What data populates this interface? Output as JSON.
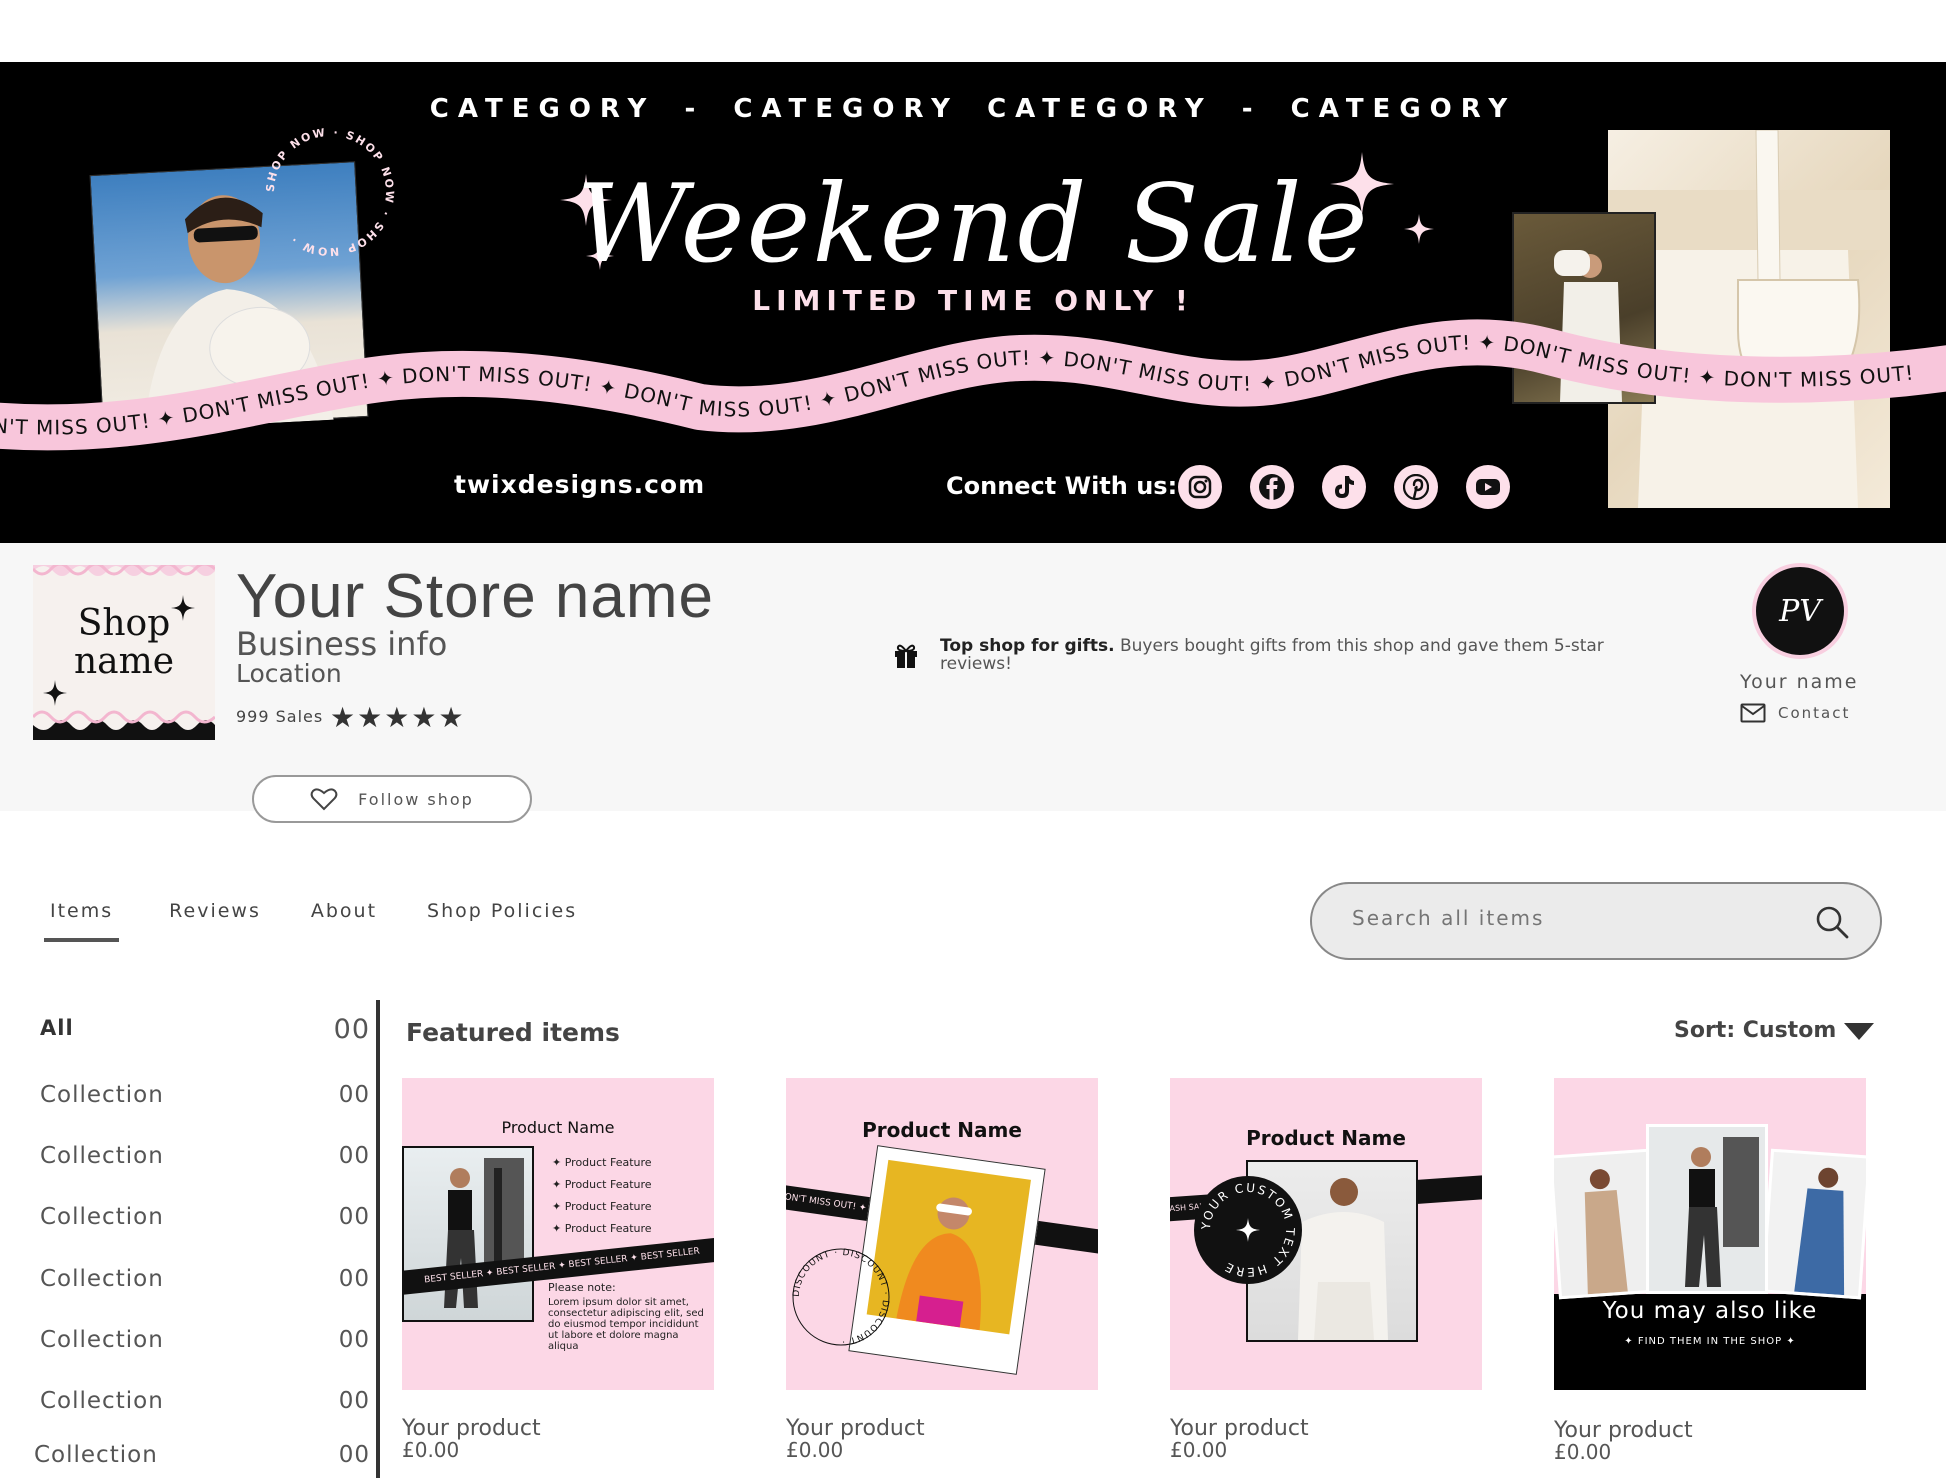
{
  "banner": {
    "categories": [
      "CATEGORY",
      "-",
      "CATEGORY",
      "CATEGORY",
      "-",
      "CATEGORY"
    ],
    "title": "Weekend Sale",
    "subtitle": "LIMITED TIME ONLY !",
    "ribbon_text": "DON'T MISS OUT! ✦ DON'T MISS OUT! ✦ DON'T MISS OUT! ✦ DON'T MISS OUT! ✦ DON'T MISS OUT! ✦ DON'T MISS OUT! ✦ DON'T MISS OUT! ✦ DON'T MISS OUT! ✦ DON'T MISS OUT!",
    "shop_now_text": "SHOP NOW · SHOP NOW · SHOP NOW ·",
    "website": "twixdesigns.com",
    "connect_label": "Connect With us:",
    "socials": [
      "instagram-icon",
      "facebook-icon",
      "tiktok-icon",
      "pinterest-icon",
      "youtube-icon"
    ]
  },
  "store": {
    "logo_text_1": "Shop",
    "logo_text_2": "name",
    "name": "Your Store name",
    "business_info": "Business info",
    "location": "Location",
    "sales": "999 Sales",
    "rating_stars": 5,
    "gift_bold": "Top shop for gifts.",
    "gift_text": " Buyers bought gifts from this shop and gave them 5-star reviews!",
    "owner_initials": "PV",
    "owner_name": "Your name",
    "contact_label": "Contact",
    "follow_label": "Follow shop"
  },
  "tabs": [
    "Items",
    "Reviews",
    "About",
    "Shop Policies"
  ],
  "search": {
    "placeholder": "Search all items"
  },
  "sidebar": [
    {
      "label": "All",
      "count": "00"
    },
    {
      "label": "Collection",
      "count": "00"
    },
    {
      "label": "Collection",
      "count": "00"
    },
    {
      "label": "Collection",
      "count": "00"
    },
    {
      "label": "Collection",
      "count": "00"
    },
    {
      "label": "Collection",
      "count": "00"
    },
    {
      "label": "Collection",
      "count": "00"
    },
    {
      "label": "Collection",
      "count": "00"
    }
  ],
  "main": {
    "featured_label": "Featured items",
    "sort_label": "Sort: Custom"
  },
  "cards": [
    {
      "product_name": "Product Name",
      "features": [
        "Product Feature",
        "Product Feature",
        "Product Feature",
        "Product Feature"
      ],
      "band_text": "BEST SELLER ✦ BEST SELLER ✦ BEST SELLER ✦ BEST SELLER",
      "note_title": "Please note:",
      "note_body": "Lorem ipsum dolor sit amet, consectetur adipiscing elit, sed do eiusmod tempor incididunt ut labore et dolore magna aliqua",
      "title": "Your product",
      "price": "£0.00"
    },
    {
      "product_name": "Product Name",
      "band_text": "DON'T MISS OUT! ✦ DON'T MISS OUT!",
      "circle_text": "DISCOUNT · DISCOUNT · DISCOUNT ·",
      "title": "Your product",
      "price": "£0.00"
    },
    {
      "product_name": "Product Name",
      "band_text": "FLASH SALE ✦ FLASH SALE ✦ FLASH SALE",
      "circle_text": "YOUR CUSTOM TEXT HERE",
      "title": "Your product",
      "price": "£0.00"
    },
    {
      "headline": "You may also like",
      "subline": "✦ FIND THEM IN THE SHOP ✦",
      "title": "Your product",
      "price": "£0.00"
    }
  ],
  "colors": {
    "accent_pink": "#fcd7e6",
    "banner_bg": "#000000",
    "text_dark": "#444444"
  }
}
